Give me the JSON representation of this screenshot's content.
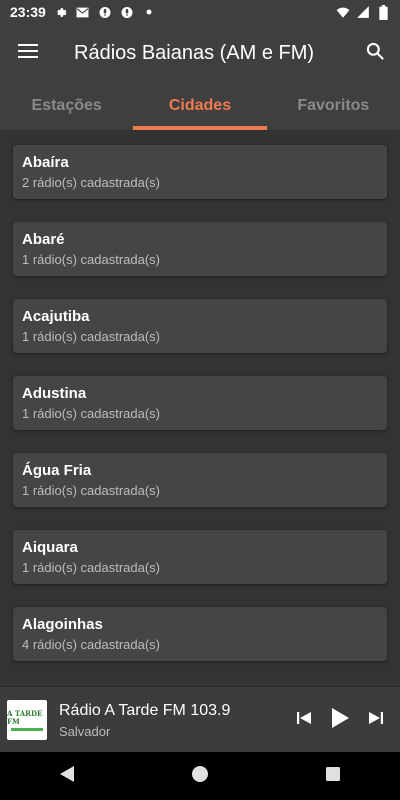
{
  "status_bar": {
    "time": "23:39",
    "icons": [
      "gear-icon",
      "gmail-icon",
      "mic-icon",
      "mic-icon",
      "dot-icon",
      "wifi-icon",
      "signal-icon",
      "battery-icon"
    ]
  },
  "app_bar": {
    "title": "Rádios Baianas (AM e FM)",
    "menu_icon": "menu-icon",
    "search_icon": "search-icon"
  },
  "tabs": [
    {
      "label": "Estações",
      "active": false
    },
    {
      "label": "Cidades",
      "active": true
    },
    {
      "label": "Favoritos",
      "active": false
    }
  ],
  "cities": [
    {
      "name": "Abaíra",
      "count": "2 rádio(s) cadastrada(s)"
    },
    {
      "name": "Abaré",
      "count": "1 rádio(s) cadastrada(s)"
    },
    {
      "name": "Acajutiba",
      "count": "1 rádio(s) cadastrada(s)"
    },
    {
      "name": "Adustina",
      "count": "1 rádio(s) cadastrada(s)"
    },
    {
      "name": "Água Fria",
      "count": "1 rádio(s) cadastrada(s)"
    },
    {
      "name": "Aiquara",
      "count": "1 rádio(s) cadastrada(s)"
    },
    {
      "name": "Alagoinhas",
      "count": "4 rádio(s) cadastrada(s)"
    }
  ],
  "player": {
    "title": "Rádio A Tarde FM 103.9",
    "subtitle": "Salvador",
    "logo_text": "A TARDE FM"
  },
  "colors": {
    "accent": "#f07a4f",
    "background": "#333333",
    "card": "#454545",
    "bar": "#3f3f3f"
  }
}
